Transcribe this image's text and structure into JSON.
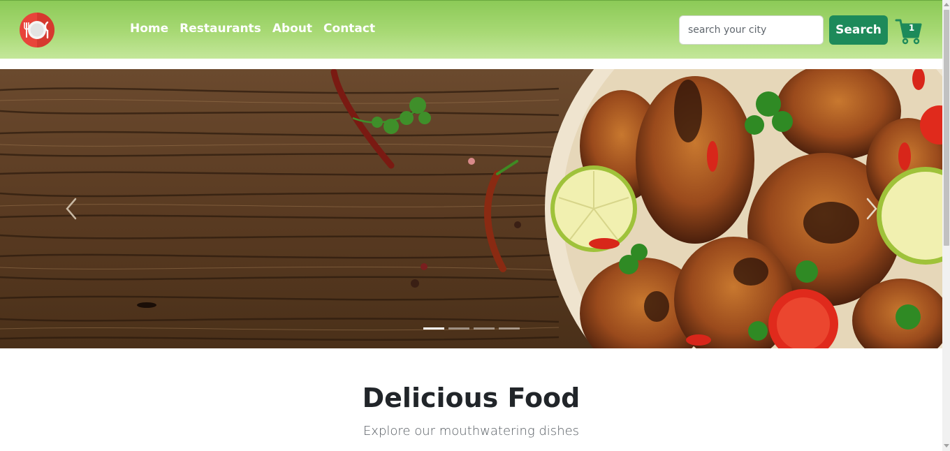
{
  "brand": {
    "logo_icon": "plate-cutlery-icon",
    "accent": "#e8443a"
  },
  "nav": {
    "links": [
      "Home",
      "Restaurants",
      "About",
      "Contact"
    ]
  },
  "search": {
    "placeholder": "search your city",
    "button_label": "Search"
  },
  "cart": {
    "icon": "cart-icon",
    "count": "1"
  },
  "carousel": {
    "slide_count": 4,
    "active_index": 0,
    "prev_icon": "chevron-left-icon",
    "next_icon": "chevron-right-icon"
  },
  "section": {
    "title": "Delicious Food",
    "subtitle": "Explore our mouthwatering dishes"
  },
  "colors": {
    "navbar_green": "#a8d975",
    "search_button": "#1d8a5a",
    "cart_green": "#1d8a5a"
  }
}
